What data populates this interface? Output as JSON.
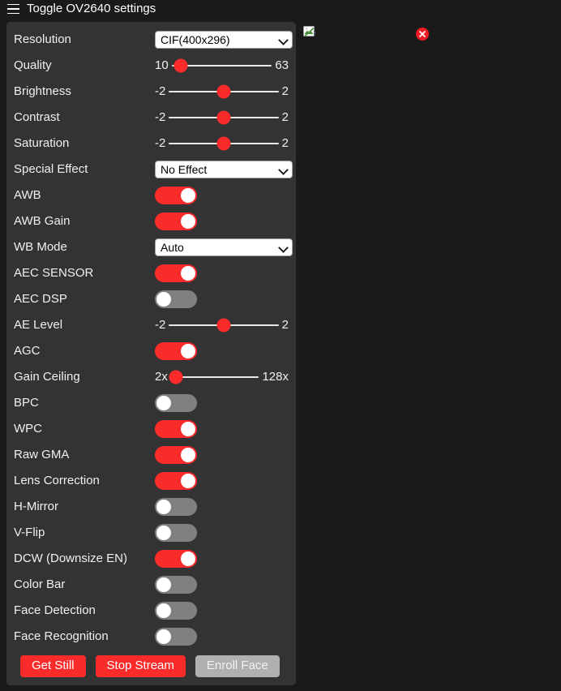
{
  "nav": {
    "menu_icon": "hamburger-icon",
    "toggle_label": "Toggle OV2640 settings"
  },
  "colors": {
    "accent": "#fa2b2b",
    "panel_bg": "#333333",
    "page_bg": "#1a1a1a",
    "switch_off": "#808080",
    "muted_button": "#b0b0b0",
    "close_badge": "#ee1b24"
  },
  "settings": [
    {
      "type": "select",
      "label": "Resolution",
      "value": "CIF(400x296)"
    },
    {
      "type": "slider",
      "label": "Quality",
      "min": "10",
      "max": "63",
      "percent": 9
    },
    {
      "type": "slider",
      "label": "Brightness",
      "min": "-2",
      "max": "2",
      "percent": 50
    },
    {
      "type": "slider",
      "label": "Contrast",
      "min": "-2",
      "max": "2",
      "percent": 50
    },
    {
      "type": "slider",
      "label": "Saturation",
      "min": "-2",
      "max": "2",
      "percent": 50
    },
    {
      "type": "select",
      "label": "Special Effect",
      "value": "No Effect"
    },
    {
      "type": "switch",
      "label": "AWB",
      "state": "on"
    },
    {
      "type": "switch",
      "label": "AWB Gain",
      "state": "on"
    },
    {
      "type": "select",
      "label": "WB Mode",
      "value": "Auto"
    },
    {
      "type": "switch",
      "label": "AEC SENSOR",
      "state": "on"
    },
    {
      "type": "switch",
      "label": "AEC DSP",
      "state": "off"
    },
    {
      "type": "slider",
      "label": "AE Level",
      "min": "-2",
      "max": "2",
      "percent": 50
    },
    {
      "type": "switch",
      "label": "AGC",
      "state": "on"
    },
    {
      "type": "slider",
      "label": "Gain Ceiling",
      "min": "2x",
      "max": "128x",
      "percent": 6
    },
    {
      "type": "switch",
      "label": "BPC",
      "state": "off"
    },
    {
      "type": "switch",
      "label": "WPC",
      "state": "on"
    },
    {
      "type": "switch",
      "label": "Raw GMA",
      "state": "on"
    },
    {
      "type": "switch",
      "label": "Lens Correction",
      "state": "on"
    },
    {
      "type": "switch",
      "label": "H-Mirror",
      "state": "off"
    },
    {
      "type": "switch",
      "label": "V-Flip",
      "state": "off"
    },
    {
      "type": "switch",
      "label": "DCW (Downsize EN)",
      "state": "on"
    },
    {
      "type": "switch",
      "label": "Color Bar",
      "state": "off"
    },
    {
      "type": "switch",
      "label": "Face Detection",
      "state": "off"
    },
    {
      "type": "switch",
      "label": "Face Recognition",
      "state": "off"
    }
  ],
  "buttons": [
    {
      "label": "Get Still",
      "style": "danger",
      "name": "get-still-button"
    },
    {
      "label": "Stop Stream",
      "style": "danger",
      "name": "stop-stream-button"
    },
    {
      "label": "Enroll Face",
      "style": "muted",
      "name": "enroll-face-button"
    }
  ],
  "stage": {
    "stream_placeholder_icon": "broken-image-icon",
    "close_icon": "close-icon"
  }
}
